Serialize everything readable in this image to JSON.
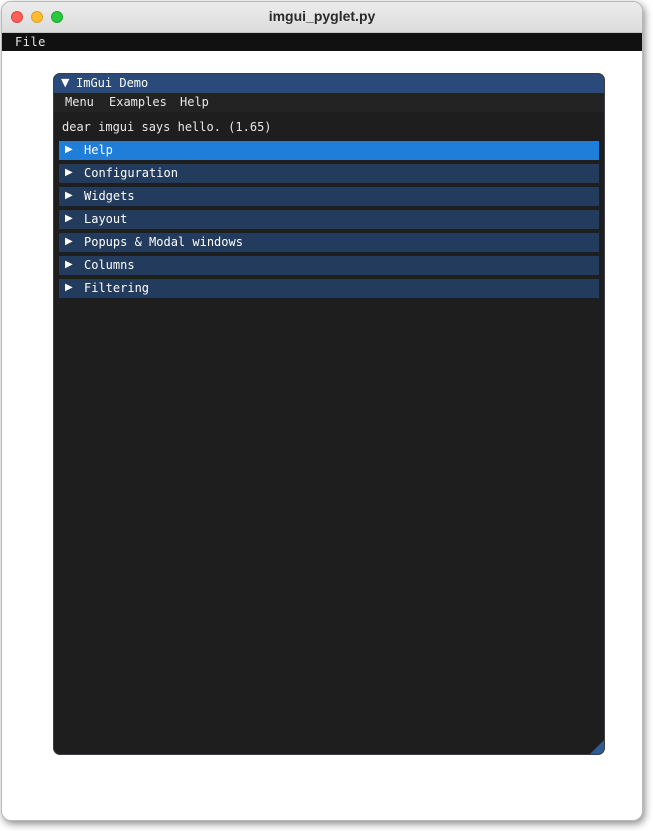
{
  "window": {
    "title": "imgui_pyglet.py"
  },
  "app_menu": {
    "file": "File"
  },
  "imgui": {
    "collapse_arrow": "▼",
    "title": "ImGui Demo",
    "menu": {
      "menu": "Menu",
      "examples": "Examples",
      "help": "Help"
    },
    "hello": "dear imgui says hello. (1.65)",
    "headers": [
      {
        "arrow": "▶",
        "label": "Help",
        "active": true
      },
      {
        "arrow": "▶",
        "label": "Configuration",
        "active": false
      },
      {
        "arrow": "▶",
        "label": "Widgets",
        "active": false
      },
      {
        "arrow": "▶",
        "label": "Layout",
        "active": false
      },
      {
        "arrow": "▶",
        "label": "Popups & Modal windows",
        "active": false
      },
      {
        "arrow": "▶",
        "label": "Columns",
        "active": false
      },
      {
        "arrow": "▶",
        "label": "Filtering",
        "active": false
      }
    ]
  },
  "colors": {
    "imgui_title": "#294a7a",
    "header": "#233b5d",
    "header_active": "#1f7ed9",
    "window_bg": "#1e1e1e"
  }
}
